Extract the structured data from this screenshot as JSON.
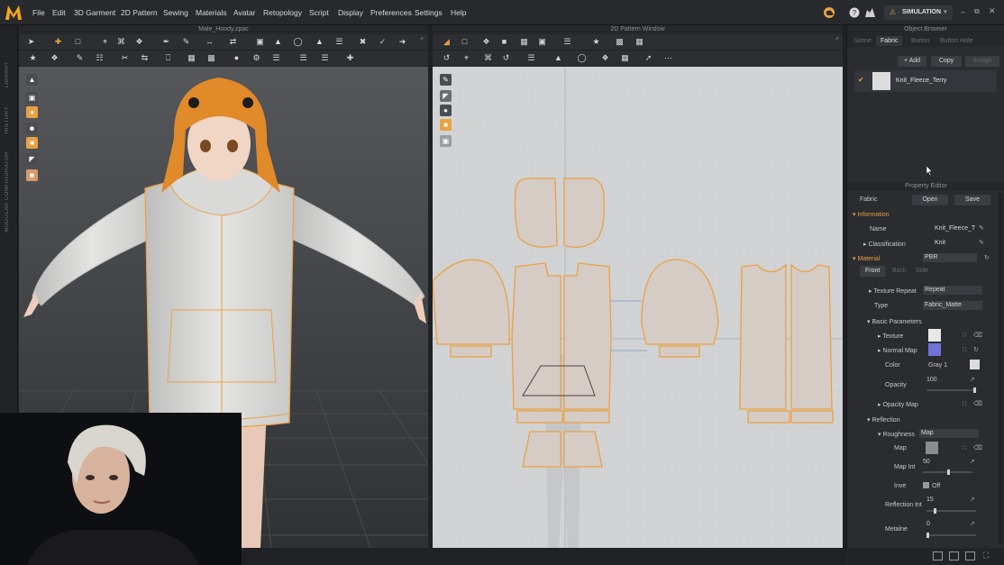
{
  "app": {
    "logo_letter": "M",
    "menus": [
      "File",
      "Edit",
      "3D Garment",
      "2D Pattern",
      "Sewing",
      "Materials",
      "Avatar",
      "Retopology",
      "Script",
      "Display",
      "Preferences",
      "Settings",
      "Help"
    ],
    "mode_label": "SIMULATION",
    "accent": "#e9a144"
  },
  "sidebar": {
    "labels": [
      "LIBRARY",
      "HISTORY",
      "MODULAR CONFIGURATOR"
    ]
  },
  "viewport3d": {
    "title": "Male_Hoody.zpac"
  },
  "viewport2d": {
    "title": "2D Pattern Window"
  },
  "object_browser": {
    "title": "Object Browser",
    "tabs": [
      "Scene",
      "Fabric",
      "Button",
      "Button Hole"
    ],
    "active_tab": "Fabric",
    "add_label": "+ Add",
    "copy_label": "Copy",
    "assign_label": "Assign",
    "fabric_item": "Knit_Fleece_Terry"
  },
  "property_editor": {
    "title": "Property Editor",
    "fabric_label": "Fabric",
    "open_label": "Open",
    "save_label": "Save",
    "information_label": "Information",
    "name_label": "Name",
    "name_value": "Knit_Fleece_T",
    "classification_label": "Classification",
    "classification_value": "Knit",
    "material_label": "Material",
    "material_value": "PBR",
    "sides": [
      "Front",
      "Back",
      "Side"
    ],
    "texture_repeat_label": "Texture Repeat",
    "texture_repeat_value": "Repeat",
    "type_label": "Type",
    "type_value": "Fabric_Matte",
    "basic_params_label": "Basic Parameters",
    "texture_label": "Texture",
    "normal_map_label": "Normal Map",
    "color_label": "Color",
    "color_value": "Gray 1",
    "opacity_label": "Opacity",
    "opacity_value": "100",
    "opacity_map_label": "Opacity Map",
    "reflection_label": "Reflection",
    "roughness_label": "Roughness",
    "roughness_value": "Map",
    "map_label": "Map",
    "map_int_label": "Map Int",
    "map_int_value": "50",
    "invert_label": "Inve",
    "invert_value": "Off",
    "reflection_int_label": "Reflection Int",
    "reflection_int_value": "15",
    "metalness_label": "Metalne",
    "metalness_value": "0"
  }
}
